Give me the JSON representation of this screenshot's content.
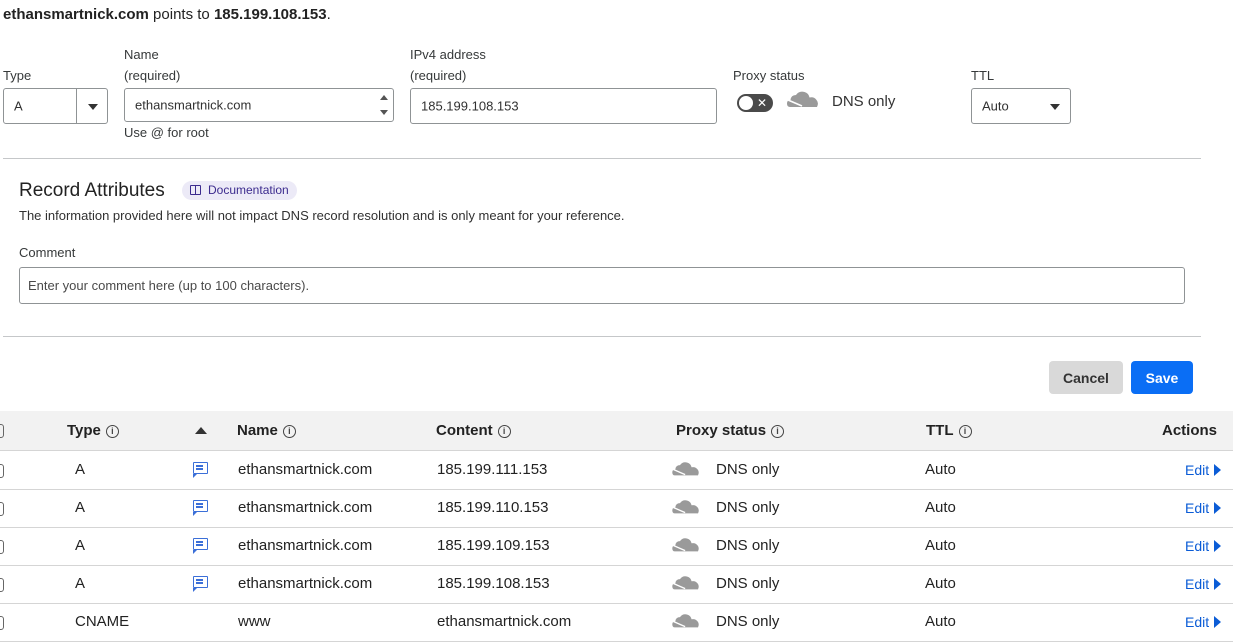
{
  "summary": {
    "name": "ethansmartnick.com",
    "mid": " points to ",
    "ip": "185.199.108.153",
    "end": "."
  },
  "form": {
    "type_label": "Type",
    "type_value": "A",
    "name_label_1": "Name",
    "name_label_2": "(required)",
    "name_value": "ethansmartnick.com",
    "name_hint": "Use @ for root",
    "ip_label_1": "IPv4 address",
    "ip_label_2": "(required)",
    "ip_value": "185.199.108.153",
    "proxy_label": "Proxy status",
    "proxy_toggle_x": "✕",
    "proxy_value": "DNS only",
    "ttl_label": "TTL",
    "ttl_value": "Auto"
  },
  "attributes": {
    "title": "Record Attributes",
    "doc_badge": "Documentation",
    "description": "The information provided here will not impact DNS record resolution and is only meant for your reference.",
    "comment_label": "Comment",
    "comment_placeholder": "Enter your comment here (up to 100 characters)."
  },
  "buttons": {
    "cancel": "Cancel",
    "save": "Save"
  },
  "table": {
    "headers": {
      "type": "Type",
      "name": "Name",
      "content": "Content",
      "proxy": "Proxy status",
      "ttl": "TTL",
      "actions": "Actions"
    },
    "info_glyph": "i",
    "rows": [
      {
        "type": "A",
        "name": "ethansmartnick.com",
        "content": "185.199.111.153",
        "proxy": "DNS only",
        "ttl": "Auto",
        "action": "Edit",
        "has_comment": true
      },
      {
        "type": "A",
        "name": "ethansmartnick.com",
        "content": "185.199.110.153",
        "proxy": "DNS only",
        "ttl": "Auto",
        "action": "Edit",
        "has_comment": true
      },
      {
        "type": "A",
        "name": "ethansmartnick.com",
        "content": "185.199.109.153",
        "proxy": "DNS only",
        "ttl": "Auto",
        "action": "Edit",
        "has_comment": true
      },
      {
        "type": "A",
        "name": "ethansmartnick.com",
        "content": "185.199.108.153",
        "proxy": "DNS only",
        "ttl": "Auto",
        "action": "Edit",
        "has_comment": true
      },
      {
        "type": "CNAME",
        "name": "www",
        "content": "ethansmartnick.com",
        "proxy": "DNS only",
        "ttl": "Auto",
        "action": "Edit",
        "has_comment": false
      }
    ]
  },
  "icons": {
    "cloud": "dns-only-cloud-icon",
    "comment": "comment-icon",
    "edit_arrow": "triangle-right-icon"
  },
  "colors": {
    "primary": "#0a6ef5",
    "link": "#0b5cd6",
    "badge_bg": "#eceaf7",
    "badge_text": "#3c2b8e"
  }
}
